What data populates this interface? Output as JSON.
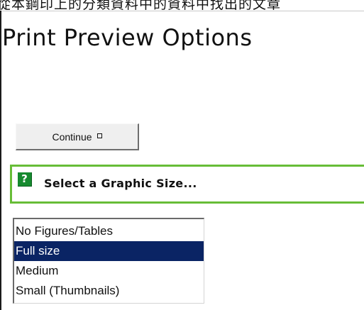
{
  "top_strip": {
    "text": "從本鋼印上的分類資料中的資料中找出的文章"
  },
  "page": {
    "title": "Print Preview Options"
  },
  "actions": {
    "continue_label": "Continue"
  },
  "graphic_size": {
    "help_icon": "?",
    "heading": "Select a Graphic Size...",
    "selected_option": "Full size",
    "options": [
      "No Figures/Tables",
      "Full size",
      "Medium",
      "Small (Thumbnails)"
    ]
  },
  "icons": {
    "continue": "small-square-icon",
    "help": "question-mark-icon"
  },
  "colors": {
    "accent_green": "#67bd37",
    "help_icon_green": "#168a2f",
    "selected_option_background": "#0a2464"
  }
}
